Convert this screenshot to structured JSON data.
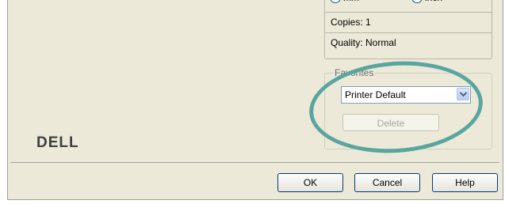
{
  "units": {
    "mm_label": "mm",
    "inch_label": "inch",
    "selected": "inch"
  },
  "summary": {
    "copies": "Copies: 1",
    "quality": "Quality: Normal"
  },
  "favorites": {
    "legend": "Favorites",
    "selected": "Printer Default",
    "delete_label": "Delete"
  },
  "logo": {
    "text": "DELL"
  },
  "footer": {
    "ok_label": "OK",
    "cancel_label": "Cancel",
    "help_label": "Help"
  },
  "colors": {
    "dialog_bg": "#ece9d8",
    "highlight_ring": "#5aa59f",
    "radio_selected": "#21a121"
  }
}
